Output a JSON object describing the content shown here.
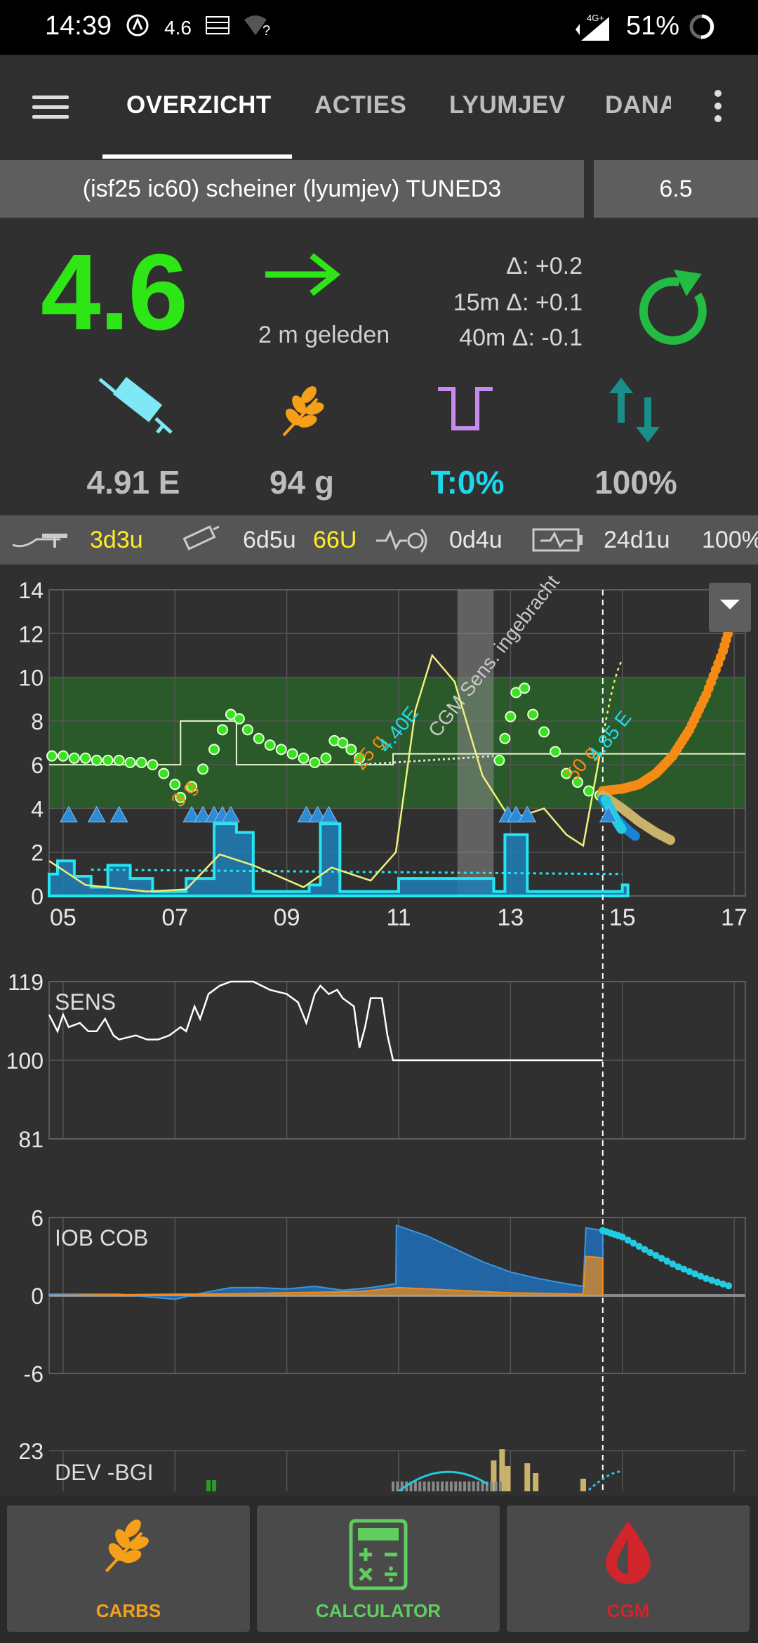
{
  "status_bar": {
    "time": "14:39",
    "bg_notification": "4.6",
    "network": "4G+",
    "battery": "51%",
    "icons": [
      "aaps-icon",
      "bg-notification",
      "speed-icon",
      "wifi-question-icon",
      "signal-icon",
      "battery-ring-icon"
    ]
  },
  "tabs": [
    "OVERZICHT",
    "ACTIES",
    "LYUMJEV",
    "DANA"
  ],
  "profile": {
    "name": "(isf25 ic60) scheiner (lyumjev) TUNED3",
    "target": "6.5"
  },
  "glucose": {
    "value": "4.6",
    "trend": "flat-arrow",
    "ago": "2 m geleden",
    "delta": "Δ: +0.2",
    "delta_15m": "15m Δ: +0.1",
    "delta_40m": "40m Δ:  -0.1",
    "colors": {
      "value": "#2ee616",
      "arrow": "#2ee616",
      "loop": "#22bb44"
    }
  },
  "stats": {
    "iob": "4.91 E",
    "cob": "94 g",
    "tbr": "T:0%",
    "autosens": "100%",
    "icons": [
      "syringe-icon",
      "wheat-icon",
      "temp-basal-icon",
      "up-down-arrows-icon"
    ]
  },
  "infobar": {
    "cannula_age": "3d3u",
    "reservoir_age": "6d5u",
    "reservoir_level": "66U",
    "sensor_age": "0d4u",
    "pump_battery_age": "24d1u",
    "pump_battery_level": "100%"
  },
  "chart_data": [
    {
      "type": "line",
      "name": "bg",
      "x_ticks": [
        "05",
        "07",
        "09",
        "11",
        "13",
        "15",
        "17"
      ],
      "y_ticks": [
        0,
        2,
        4,
        6,
        8,
        10,
        12,
        14
      ],
      "ylim": [
        0,
        14
      ],
      "xlim": [
        4.75,
        17.2
      ],
      "target_range": [
        4,
        10
      ],
      "now": 14.65,
      "bg_points": [
        [
          4.8,
          6.4
        ],
        [
          5.0,
          6.4
        ],
        [
          5.2,
          6.3
        ],
        [
          5.4,
          6.3
        ],
        [
          5.6,
          6.2
        ],
        [
          5.8,
          6.2
        ],
        [
          6.0,
          6.2
        ],
        [
          6.2,
          6.1
        ],
        [
          6.4,
          6.1
        ],
        [
          6.6,
          6.0
        ],
        [
          6.8,
          5.6
        ],
        [
          7.0,
          5.1
        ],
        [
          7.1,
          4.5
        ],
        [
          7.3,
          5.0
        ],
        [
          7.5,
          5.8
        ],
        [
          7.7,
          6.7
        ],
        [
          7.85,
          7.6
        ],
        [
          8.0,
          8.3
        ],
        [
          8.15,
          8.1
        ],
        [
          8.3,
          7.6
        ],
        [
          8.5,
          7.2
        ],
        [
          8.7,
          6.9
        ],
        [
          8.9,
          6.7
        ],
        [
          9.1,
          6.5
        ],
        [
          9.3,
          6.3
        ],
        [
          9.5,
          6.1
        ],
        [
          9.7,
          6.3
        ],
        [
          9.85,
          7.1
        ],
        [
          10.0,
          7.0
        ],
        [
          10.15,
          6.7
        ],
        [
          10.3,
          6.3
        ],
        [
          12.8,
          6.2
        ],
        [
          12.9,
          7.2
        ],
        [
          13.0,
          8.2
        ],
        [
          13.1,
          9.3
        ],
        [
          13.25,
          9.5
        ],
        [
          13.4,
          8.3
        ],
        [
          13.6,
          7.5
        ],
        [
          13.8,
          6.6
        ],
        [
          14.0,
          5.6
        ],
        [
          14.2,
          5.2
        ],
        [
          14.4,
          4.8
        ],
        [
          14.6,
          4.6
        ]
      ],
      "predictions": {
        "orange": [
          [
            14.65,
            4.8
          ],
          [
            15.0,
            4.9
          ],
          [
            15.3,
            5.1
          ],
          [
            15.6,
            5.6
          ],
          [
            15.9,
            6.4
          ],
          [
            16.2,
            7.6
          ],
          [
            16.5,
            9.2
          ],
          [
            16.8,
            11.2
          ],
          [
            17.0,
            13.0
          ]
        ],
        "tan": [
          [
            14.65,
            4.6
          ],
          [
            15.0,
            4.0
          ],
          [
            15.3,
            3.4
          ],
          [
            15.6,
            2.9
          ],
          [
            15.9,
            2.5
          ]
        ],
        "blue": [
          [
            14.65,
            4.4
          ],
          [
            14.9,
            3.5
          ],
          [
            15.1,
            3.0
          ],
          [
            15.25,
            2.7
          ]
        ],
        "cyan_dot": [
          [
            14.7,
            4.4
          ],
          [
            14.9,
            3.4
          ],
          [
            15.0,
            3.0
          ]
        ]
      },
      "carbs_labels": [
        {
          "x": 7.1,
          "y": 4.0,
          "text": "3 g"
        },
        {
          "x": 10.35,
          "y": 5.7,
          "text": "25 g"
        },
        {
          "x": 14.15,
          "y": 5.2,
          "text": "50 g"
        }
      ],
      "bolus_labels": [
        {
          "x": 10.8,
          "y": 6.5,
          "text": "4.40E"
        },
        {
          "x": 14.55,
          "y": 6.1,
          "text": "4.85 E"
        }
      ],
      "event_label": "CGM Sens. ingebracht",
      "basal": [
        [
          4.75,
          1.0
        ],
        [
          4.9,
          1.6
        ],
        [
          5.2,
          0.9
        ],
        [
          5.5,
          0.4
        ],
        [
          5.8,
          1.4
        ],
        [
          6.2,
          0.8
        ],
        [
          6.6,
          0.2
        ],
        [
          7.2,
          0.8
        ],
        [
          7.7,
          3.3
        ],
        [
          8.1,
          2.9
        ],
        [
          8.4,
          0.2
        ],
        [
          9.4,
          0.5
        ],
        [
          9.6,
          3.3
        ],
        [
          9.95,
          0.2
        ],
        [
          11.0,
          0.8
        ],
        [
          12.1,
          0.8
        ],
        [
          12.7,
          0.2
        ],
        [
          12.9,
          2.8
        ],
        [
          13.3,
          0.2
        ],
        [
          15.0,
          0.5
        ]
      ]
    },
    {
      "type": "line",
      "name": "SENS",
      "title": "SENS",
      "y_ticks": [
        81,
        100,
        119
      ],
      "ylim": [
        81,
        119
      ],
      "values": [
        [
          4.75,
          111
        ],
        [
          4.9,
          107
        ],
        [
          5.0,
          111
        ],
        [
          5.1,
          108
        ],
        [
          5.3,
          109
        ],
        [
          5.45,
          107
        ],
        [
          5.6,
          107
        ],
        [
          5.75,
          110
        ],
        [
          5.9,
          106
        ],
        [
          6.0,
          105
        ],
        [
          6.3,
          106
        ],
        [
          6.5,
          105
        ],
        [
          6.7,
          105
        ],
        [
          6.9,
          106
        ],
        [
          7.1,
          108
        ],
        [
          7.2,
          107
        ],
        [
          7.35,
          113
        ],
        [
          7.45,
          110
        ],
        [
          7.6,
          116
        ],
        [
          7.8,
          118
        ],
        [
          8.0,
          119
        ],
        [
          8.4,
          119
        ],
        [
          8.7,
          117
        ],
        [
          9.0,
          116
        ],
        [
          9.1,
          115
        ],
        [
          9.2,
          114
        ],
        [
          9.35,
          109
        ],
        [
          9.5,
          116
        ],
        [
          9.6,
          118
        ],
        [
          9.75,
          116
        ],
        [
          9.9,
          117
        ],
        [
          10.0,
          115
        ],
        [
          10.2,
          113
        ],
        [
          10.3,
          103
        ],
        [
          10.4,
          108
        ],
        [
          10.5,
          115
        ],
        [
          10.7,
          115
        ],
        [
          10.8,
          106
        ],
        [
          10.9,
          100
        ],
        [
          14.65,
          100
        ]
      ]
    },
    {
      "type": "area",
      "name": "IOB COB",
      "title": "IOB COB",
      "y_ticks": [
        -6,
        0,
        6
      ],
      "ylim": [
        -6,
        6
      ],
      "iob": [
        [
          4.75,
          0.1
        ],
        [
          6.0,
          0.1
        ],
        [
          6.5,
          -0.1
        ],
        [
          7.0,
          -0.3
        ],
        [
          7.5,
          0.2
        ],
        [
          8.0,
          0.6
        ],
        [
          8.5,
          0.6
        ],
        [
          9.0,
          0.5
        ],
        [
          9.5,
          0.7
        ],
        [
          10.0,
          0.4
        ],
        [
          10.5,
          0.6
        ],
        [
          10.95,
          0.9
        ],
        [
          10.96,
          5.4
        ],
        [
          11.5,
          4.6
        ],
        [
          12.0,
          3.6
        ],
        [
          12.5,
          2.6
        ],
        [
          13.0,
          1.8
        ],
        [
          13.5,
          1.3
        ],
        [
          14.0,
          0.9
        ],
        [
          14.3,
          0.7
        ],
        [
          14.35,
          5.2
        ],
        [
          14.65,
          5.0
        ],
        [
          15.0,
          4.5
        ],
        [
          15.5,
          3.3
        ],
        [
          16.0,
          2.2
        ],
        [
          16.5,
          1.3
        ],
        [
          17.0,
          0.6
        ]
      ],
      "cob": [
        [
          4.75,
          0
        ],
        [
          7.1,
          0.1
        ],
        [
          7.6,
          0.1
        ],
        [
          10.3,
          0.3
        ],
        [
          11.0,
          0.6
        ],
        [
          12.0,
          0.4
        ],
        [
          12.5,
          0.3
        ],
        [
          13.0,
          0.2
        ],
        [
          14.3,
          0.1
        ],
        [
          14.35,
          3.0
        ],
        [
          14.65,
          2.9
        ]
      ]
    },
    {
      "type": "bar",
      "name": "DEV -BGI",
      "title": "DEV -BGI",
      "y_ticks": [
        23
      ],
      "ylim": [
        -23,
        23
      ]
    }
  ],
  "bottom_buttons": [
    {
      "label": "CARBS",
      "color": "#f6a01a"
    },
    {
      "label": "CALCULATOR",
      "color": "#5fce5f"
    },
    {
      "label": "CGM",
      "color": "#d0262b"
    }
  ]
}
